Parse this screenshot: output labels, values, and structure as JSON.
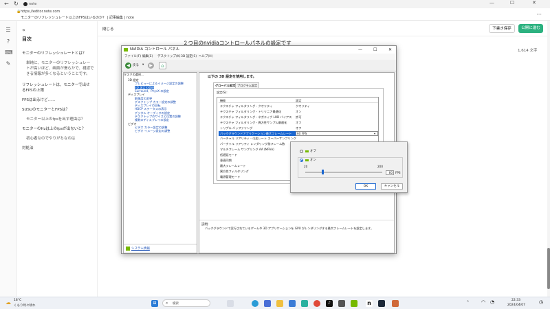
{
  "browser": {
    "tab_title": "note",
    "url": "https://editor.note.com",
    "page_title": "モニターのリフレッシュレート以上のFPSはいるのか？ | 記事編集 | note"
  },
  "toc": {
    "collapse_label": "«",
    "heading": "目次",
    "items": [
      {
        "text": "モニターのリフレッシュレートとは？",
        "level": 2
      },
      {
        "text": "単純に、モニターのリフレッシュレー",
        "level": 3
      },
      {
        "text": "トが高いほど、画面が滑らかで、視認で",
        "level": 3
      },
      {
        "text": "きる情報が多くなるということです。",
        "level": 3
      },
      {
        "text": "リフレッシュレートは、モニターで出せ",
        "level": 2
      },
      {
        "text": "るFPSの上限",
        "level": 2
      },
      {
        "text": "FPSは出るけど……",
        "level": 2
      },
      {
        "text": "SUSUのモニターとFPSは？",
        "level": 2
      },
      {
        "text": "モニター以上のfpsを出す理由は？",
        "level": 3
      },
      {
        "text": "モニターのHzは上のfpsが出ないと？",
        "level": 2
      },
      {
        "text": "初心者なのでやりがちなのは",
        "level": 3
      },
      {
        "text": "対処法",
        "level": 2
      }
    ]
  },
  "editor": {
    "close_label": "閉じる",
    "save_draft_label": "下書き保存",
    "publish_label": "公開に進む",
    "heading_text": "２つ目のnvidiaコントロールパネルの設定です",
    "char_count": "1,614 文字"
  },
  "nvidia": {
    "title": "NVIDIA コントロール パネル",
    "menu": [
      "ファイル(F)",
      "編集(E)",
      "デスクトップ(K)",
      "3D 設定(S)",
      "ヘルプ(H)"
    ],
    "back_label": "戻る",
    "task_label": "タスクの選択...",
    "tree": [
      {
        "text": "3D 設定",
        "level": 0,
        "link": false
      },
      {
        "text": "プレビューによるイメージ設定の調整",
        "level": 1,
        "link": true
      },
      {
        "text": "3D 設定の管理",
        "level": 1,
        "link": true,
        "selected": true
      },
      {
        "text": "Surround、PhysX の設定",
        "level": 1,
        "link": true
      },
      {
        "text": "ディスプレイ",
        "level": 0,
        "link": false
      },
      {
        "text": "解像度の変更",
        "level": 1,
        "link": true
      },
      {
        "text": "デスクトップ カラー設定の調整",
        "level": 1,
        "link": true
      },
      {
        "text": "ディスプレイの回転",
        "level": 1,
        "link": true
      },
      {
        "text": "HDCP ステータスの表示",
        "level": 1,
        "link": true
      },
      {
        "text": "デジタル オーディオの設定",
        "level": 1,
        "link": true
      },
      {
        "text": "デスクトップのサイズと位置の調整",
        "level": 1,
        "link": true
      },
      {
        "text": "複数のディスプレイの設定",
        "level": 1,
        "link": true
      },
      {
        "text": "ビデオ",
        "level": 0,
        "link": false
      },
      {
        "text": "ビデオ カラー設定の調整",
        "level": 1,
        "link": true
      },
      {
        "text": "ビデオ イメージ設定の調整",
        "level": 1,
        "link": true
      }
    ],
    "system_info": "システム情報",
    "section_heading": "以下の 3D 設定を使用します。",
    "tabs": [
      "グローバル設定",
      "プログラム設定"
    ],
    "settings_label": "設定(S):",
    "col_feature": "機能",
    "col_setting": "設定",
    "rows": [
      {
        "name": "テクスチャ フィルタリング - クオリティ",
        "value": "クオリティ"
      },
      {
        "name": "テクスチャ フィルタリング - トリリニア最適化",
        "value": "オン"
      },
      {
        "name": "テクスチャ フィルタリング - ネガティブ LOD バイアス",
        "value": "許可"
      },
      {
        "name": "テクスチャ フィルタリング - 異方性サンプル最適化",
        "value": "オフ"
      },
      {
        "name": "トリプル バッファリング",
        "value": "オフ"
      },
      {
        "name": "バックグラウンドアプリケーション最大フレームレート",
        "value": "60 FPS",
        "selected": true
      },
      {
        "name": "バーチャル リアリティ - 可変レート スーパーサンプリング",
        "value": ""
      },
      {
        "name": "バーチャル リアリティ レンダリング前フレーム数",
        "value": ""
      },
      {
        "name": "マルチフレーム サンプリング AA (MFAA)",
        "value": ""
      },
      {
        "name": "低遅延モード",
        "value": ""
      },
      {
        "name": "垂直同期",
        "value": ""
      },
      {
        "name": "最大フレームレート",
        "value": ""
      },
      {
        "name": "異方性フィルタリング",
        "value": ""
      },
      {
        "name": "電源管理モード",
        "value": ""
      }
    ],
    "restore_label": "復元(T)",
    "description_label": "説明:",
    "description_text": "バックグラウンドで実行されているゲームや 3D アプリケーションを GPU がレンダリングする最大フレームレートを設定します。",
    "popup": {
      "off_label": "オフ",
      "on_label": "オン",
      "min": "20",
      "max": "200",
      "value": "60",
      "unit": "FPS",
      "ok_label": "OK",
      "cancel_label": "キャンセル"
    }
  },
  "taskbar": {
    "temperature": "18°C",
    "weather": "くもり時々晴れ",
    "search_placeholder": "検索",
    "time": "22:33",
    "date": "2024/04/07"
  }
}
